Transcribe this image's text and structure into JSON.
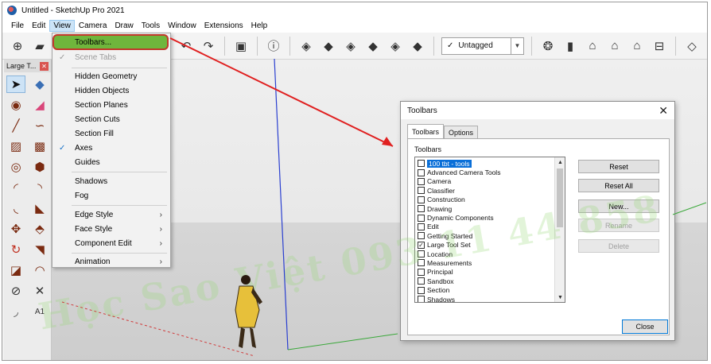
{
  "window": {
    "title": "Untitled - SketchUp Pro 2021"
  },
  "menubar": {
    "items": [
      "File",
      "Edit",
      "View",
      "Camera",
      "Draw",
      "Tools",
      "Window",
      "Extensions",
      "Help"
    ]
  },
  "toolbar": {
    "tag_select_value": "Untagged"
  },
  "palette": {
    "title": "Large T..."
  },
  "view_menu": {
    "items": [
      {
        "label": "Toolbars..."
      },
      {
        "label": "Scene Tabs"
      },
      {
        "label": "Hidden Geometry"
      },
      {
        "label": "Hidden Objects"
      },
      {
        "label": "Section Planes"
      },
      {
        "label": "Section Cuts"
      },
      {
        "label": "Section Fill"
      },
      {
        "label": "Axes"
      },
      {
        "label": "Guides"
      },
      {
        "label": "Shadows"
      },
      {
        "label": "Fog"
      },
      {
        "label": "Edge Style"
      },
      {
        "label": "Face Style"
      },
      {
        "label": "Component Edit"
      },
      {
        "label": "Animation"
      }
    ]
  },
  "dialog": {
    "title": "Toolbars",
    "tabs": [
      "Toolbars",
      "Options"
    ],
    "group_label": "Toolbars",
    "list_items": [
      {
        "label": "100 tbt - tools",
        "checked": false
      },
      {
        "label": "Advanced Camera Tools",
        "checked": false
      },
      {
        "label": "Camera",
        "checked": false
      },
      {
        "label": "Classifier",
        "checked": false
      },
      {
        "label": "Construction",
        "checked": false
      },
      {
        "label": "Drawing",
        "checked": false
      },
      {
        "label": "Dynamic Components",
        "checked": false
      },
      {
        "label": "Edit",
        "checked": false
      },
      {
        "label": "Getting Started",
        "checked": false
      },
      {
        "label": "Large Tool Set",
        "checked": true
      },
      {
        "label": "Location",
        "checked": false
      },
      {
        "label": "Measurements",
        "checked": false
      },
      {
        "label": "Principal",
        "checked": false
      },
      {
        "label": "Sandbox",
        "checked": false
      },
      {
        "label": "Section",
        "checked": false
      },
      {
        "label": "Shadows",
        "checked": false
      }
    ],
    "buttons": {
      "reset": "Reset",
      "reset_all": "Reset All",
      "new": "New...",
      "rename": "Rename",
      "delete": "Delete",
      "close": "Close"
    }
  },
  "watermark": {
    "text": "Học Sao Việt 093 11 44 858"
  },
  "colors": {
    "menu_highlight": "#6fb63c",
    "highlight_border": "#c0392b",
    "list_selection": "#0a6fd8",
    "arrow": "#e02020",
    "axis_red": "#d03a3a",
    "axis_green": "#3aa83a",
    "axis_blue": "#2a3fd0"
  }
}
